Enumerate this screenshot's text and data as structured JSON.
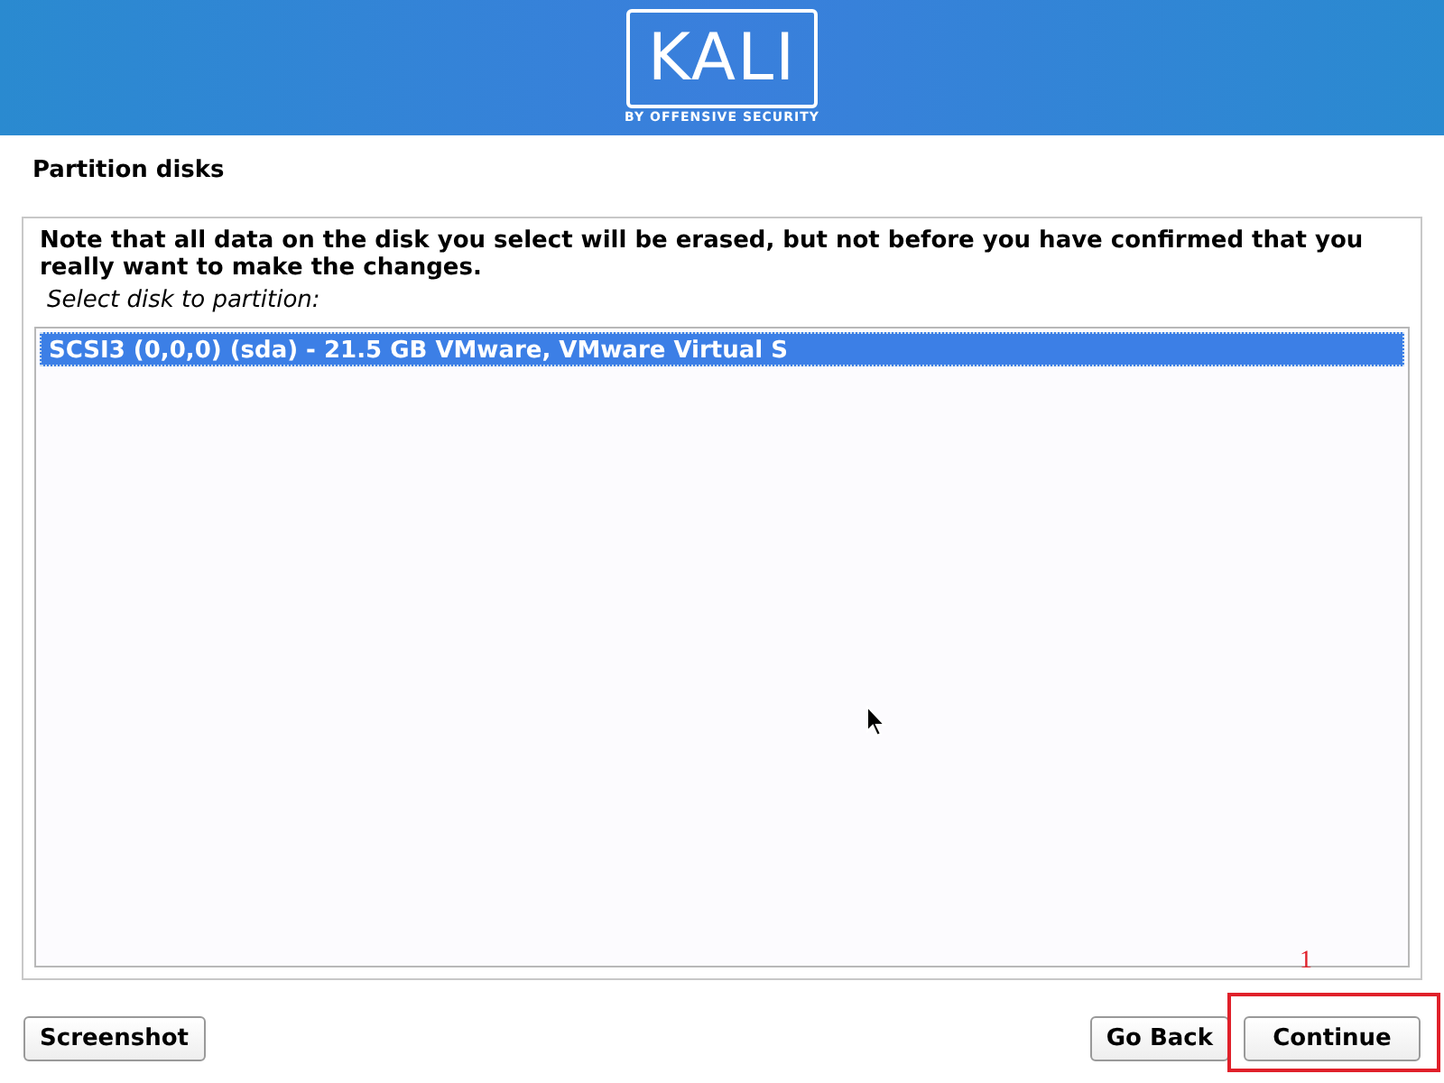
{
  "header": {
    "logo_text": "KALI",
    "logo_tagline": "BY OFFENSIVE SECURITY"
  },
  "title": "Partition disks",
  "note": "Note that all data on the disk you select will be erased, but not before you have confirmed that you really want to make the changes.",
  "prompt": "Select disk to partition:",
  "disks": [
    {
      "label": "SCSI3 (0,0,0) (sda) - 21.5 GB VMware, VMware Virtual S",
      "selected": true
    }
  ],
  "buttons": [
    {
      "label": "Screenshot",
      "kind": "left"
    },
    {
      "label": "Go Back",
      "kind": "right"
    },
    {
      "label": "Continue",
      "kind": "right",
      "annotation": "1"
    }
  ]
}
